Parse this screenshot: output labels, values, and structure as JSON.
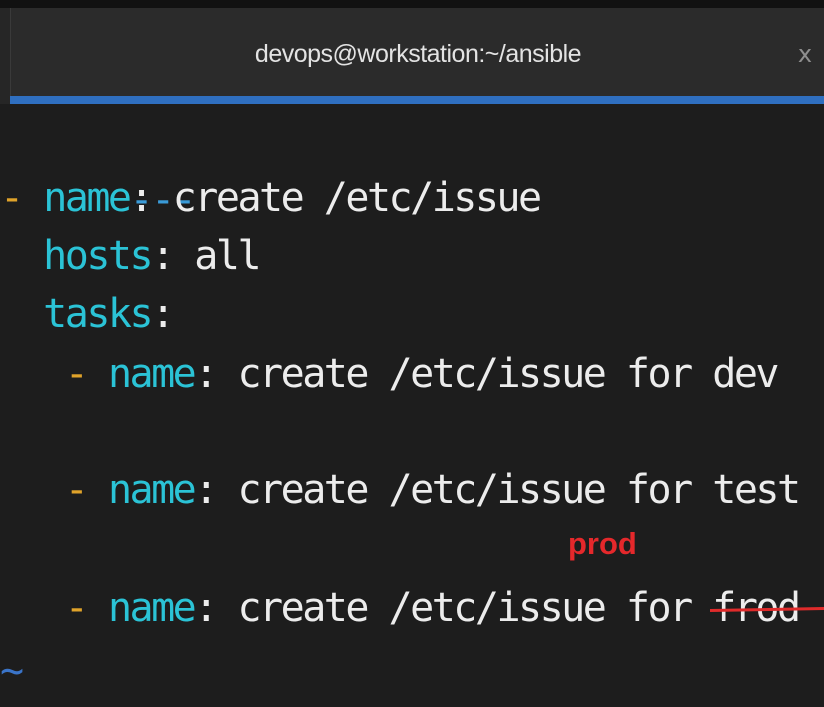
{
  "window": {
    "title": "devops@workstation:~/ansible",
    "close_glyph": "x",
    "accent_color": "#2f6fc0"
  },
  "editor": {
    "doc_start": "---",
    "play": {
      "dash": "-",
      "name_key": "name",
      "name_value": "create /etc/issue",
      "hosts_key": "hosts",
      "hosts_value": "all",
      "tasks_key": "tasks"
    },
    "tasks": [
      {
        "dash": "-",
        "key": "name",
        "value_prefix": "create /etc/issue for ",
        "value_suffix": "dev"
      },
      {
        "dash": "-",
        "key": "name",
        "value_prefix": "create /etc/issue for ",
        "value_suffix": "test"
      },
      {
        "dash": "-",
        "key": "name",
        "value_prefix": "create /etc/issue for ",
        "value_suffix": "frod"
      }
    ],
    "empty_line_marker": "~",
    "colon": ":"
  },
  "annotation": {
    "correction_text": "prod",
    "color": "#e5282b"
  }
}
